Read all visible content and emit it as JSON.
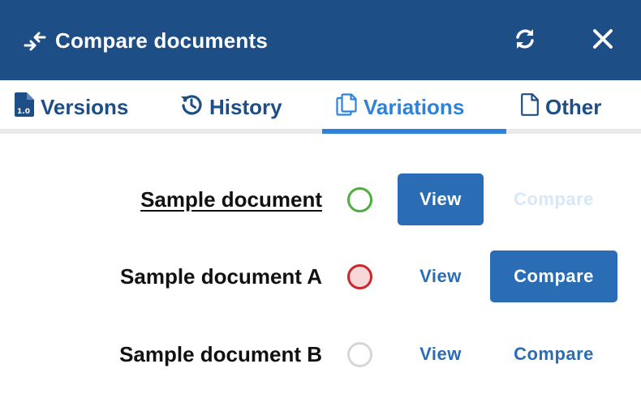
{
  "header": {
    "title": "Compare documents",
    "icon": "compare-arrows-icon",
    "refresh_icon": "refresh-icon",
    "close_icon": "close-icon",
    "background": "#1d4e85"
  },
  "tabs": [
    {
      "label": "Versions",
      "icon": "versions-file-icon",
      "active": false
    },
    {
      "label": "History",
      "icon": "history-icon",
      "active": false
    },
    {
      "label": "Variations",
      "icon": "copies-icon",
      "active": true
    },
    {
      "label": "Other",
      "icon": "document-icon",
      "active": false
    }
  ],
  "accent": "#2e82dc",
  "documents": [
    {
      "name": "Sample document",
      "status": "green",
      "is_current": true,
      "view_label": "View",
      "compare_label": "Compare",
      "view_style": "solid",
      "compare_style": "disabled"
    },
    {
      "name": "Sample document A",
      "status": "red",
      "is_current": false,
      "view_label": "View",
      "compare_label": "Compare",
      "view_style": "link",
      "compare_style": "solid"
    },
    {
      "name": "Sample document B",
      "status": "grey",
      "is_current": false,
      "view_label": "View",
      "compare_label": "Compare",
      "view_style": "link",
      "compare_style": "link"
    }
  ]
}
